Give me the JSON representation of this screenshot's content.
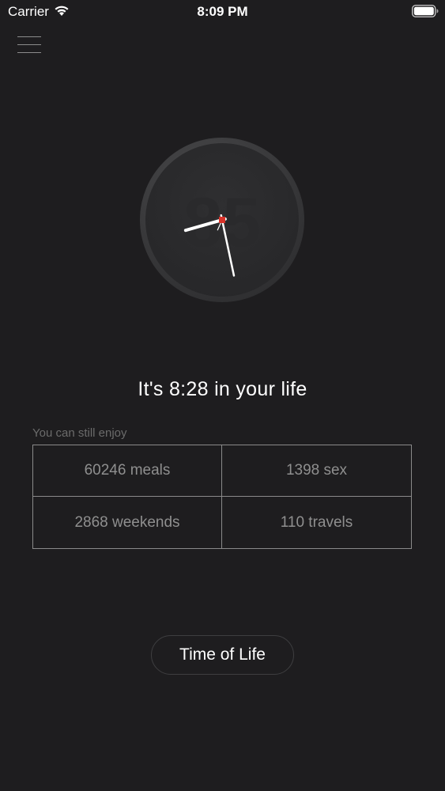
{
  "status_bar": {
    "carrier": "Carrier",
    "time": "8:09 PM",
    "icons": [
      "wifi-icon",
      "battery-icon"
    ]
  },
  "header": {
    "menu_icon": "hamburger-menu-icon"
  },
  "clock": {
    "face_digits": "85",
    "hour_hand_hour": 8,
    "minute_hand_minute": 28,
    "second_hand_seconds": 34,
    "colors": {
      "face": "#2b2b2d",
      "rim": "#3a3a3c",
      "hand": "#ffffff",
      "center": "#d9332a"
    }
  },
  "main": {
    "headline": "It's 8:28 in your life",
    "subtitle": "You can still enjoy",
    "stats": [
      {
        "label": "60246 meals"
      },
      {
        "label": "1398 sex"
      },
      {
        "label": "2868 weekends"
      },
      {
        "label": "110 travels"
      }
    ],
    "button_label": "Time of Life"
  },
  "colors": {
    "background": "#1e1d1f",
    "grid_border": "#8a8a8a",
    "stat_text": "#8f8f8f",
    "subtitle_text": "#6b6b6b"
  }
}
